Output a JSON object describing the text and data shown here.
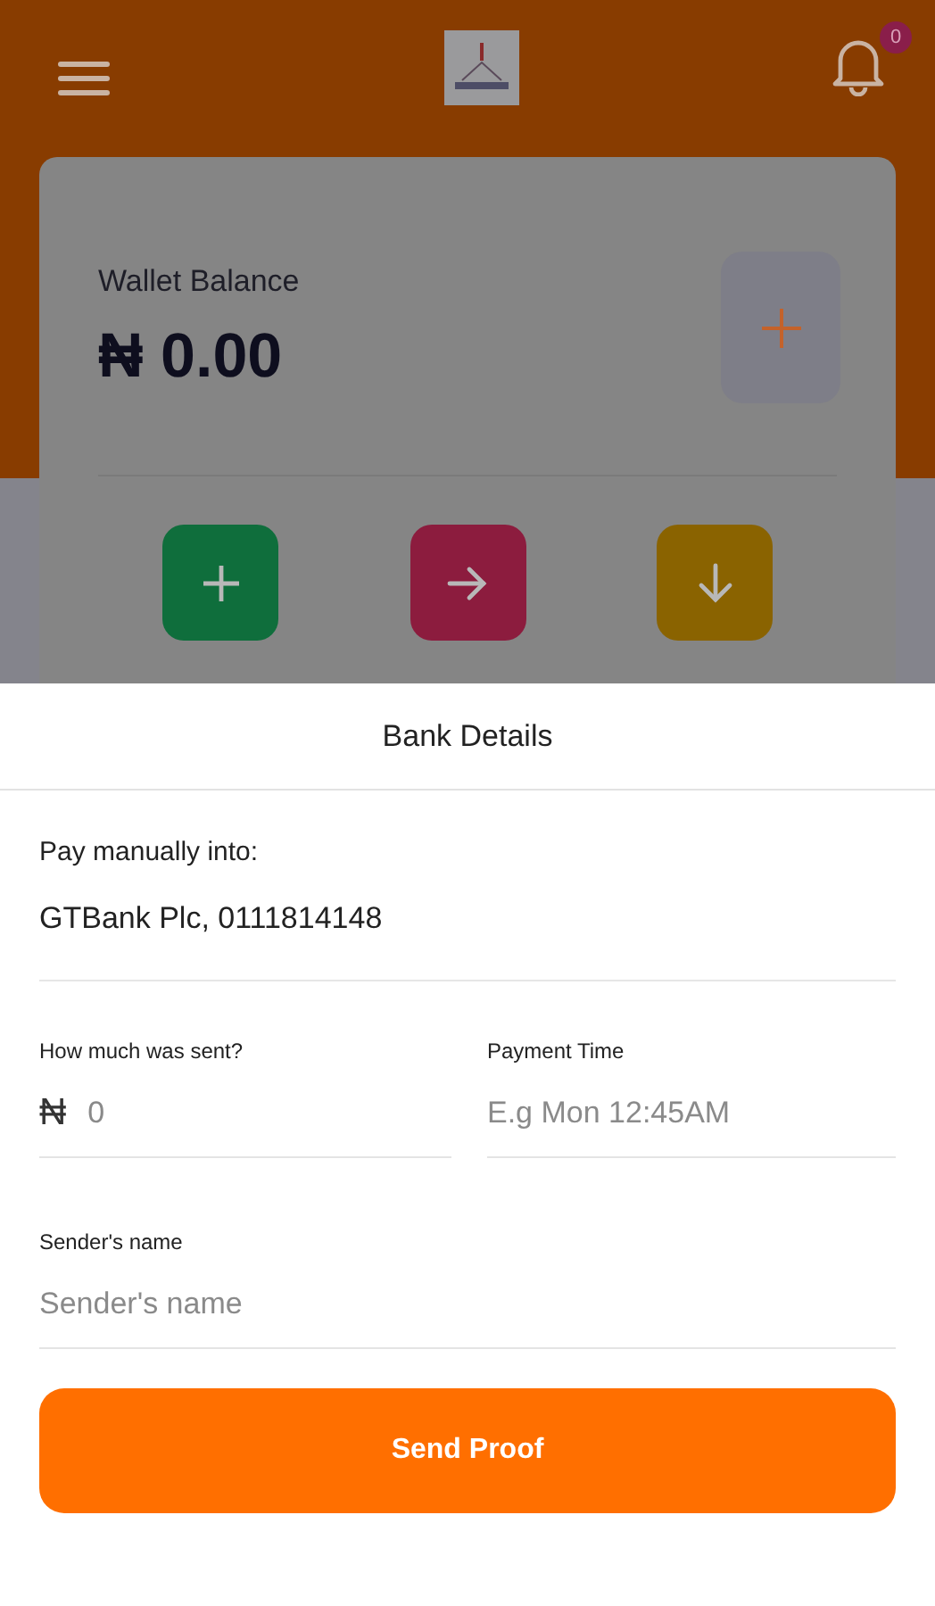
{
  "header": {
    "notification_count": "0"
  },
  "wallet": {
    "label": "Wallet Balance",
    "balance": "₦ 0.00"
  },
  "actions": [
    {
      "kind": "add",
      "color": "#0f6e3c"
    },
    {
      "kind": "send",
      "color": "#8c1c3e"
    },
    {
      "kind": "withdraw",
      "color": "#8a6300"
    }
  ],
  "sheet": {
    "title": "Bank Details",
    "instruction": "Pay manually into:",
    "account": "GTBank Plc, 0111814148",
    "fields": [
      {
        "label": "How much was sent?",
        "prefix": "₦",
        "placeholder": "0",
        "wide": false
      },
      {
        "label": "Payment Time",
        "placeholder": "E.g Mon 12:45AM",
        "wide": false
      },
      {
        "label": "Sender's name",
        "placeholder": "Sender's name",
        "wide": true
      }
    ],
    "submit": "Send Proof"
  }
}
